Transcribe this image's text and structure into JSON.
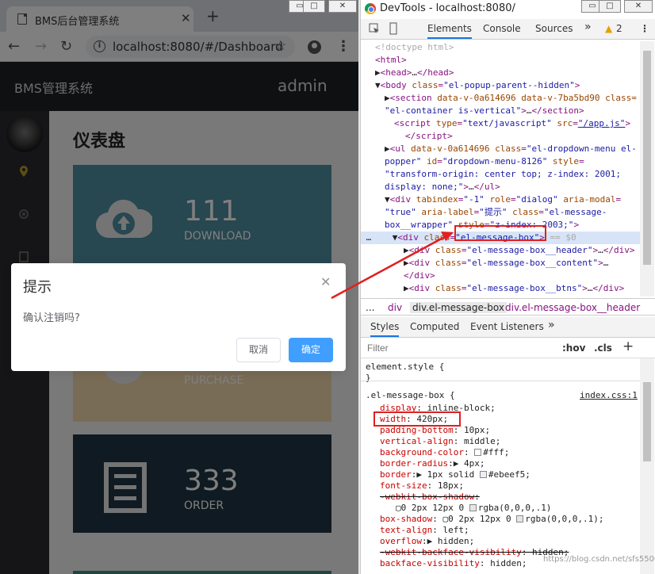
{
  "browser": {
    "tab_title": "BMS后台管理系统",
    "url": "localhost:8080/#/Dashboard"
  },
  "app": {
    "brand": "BMS管理系统",
    "user": "admin",
    "page_title": "仪表盘",
    "cards": [
      {
        "number": "111",
        "label": "DOWNLOAD",
        "color": "#4f8fa3"
      },
      {
        "number": "",
        "label": "PURCHASE",
        "color": "#f0d9ad"
      },
      {
        "number": "333",
        "label": "ORDER",
        "color": "#1f3545"
      }
    ]
  },
  "dialog": {
    "title": "提示",
    "message": "确认注销吗?",
    "cancel": "取消",
    "confirm": "确定"
  },
  "devtools": {
    "title": "DevTools - localhost:8080/",
    "tabs": [
      "Elements",
      "Console",
      "Sources"
    ],
    "more": "»",
    "warning_count": "2",
    "breadcrumb": [
      "...",
      "div",
      "div.el-message-box",
      "div.el-message-box__header"
    ],
    "styles_tabs": [
      "Styles",
      "Computed",
      "Event Listeners",
      "»"
    ],
    "filter_placeholder": "Filter",
    "hov": ":hov",
    "cls": ".cls",
    "plus": "+",
    "rule_source": "index.css:1",
    "watermark": "https://blog.csdn.net/sfs5500"
  }
}
